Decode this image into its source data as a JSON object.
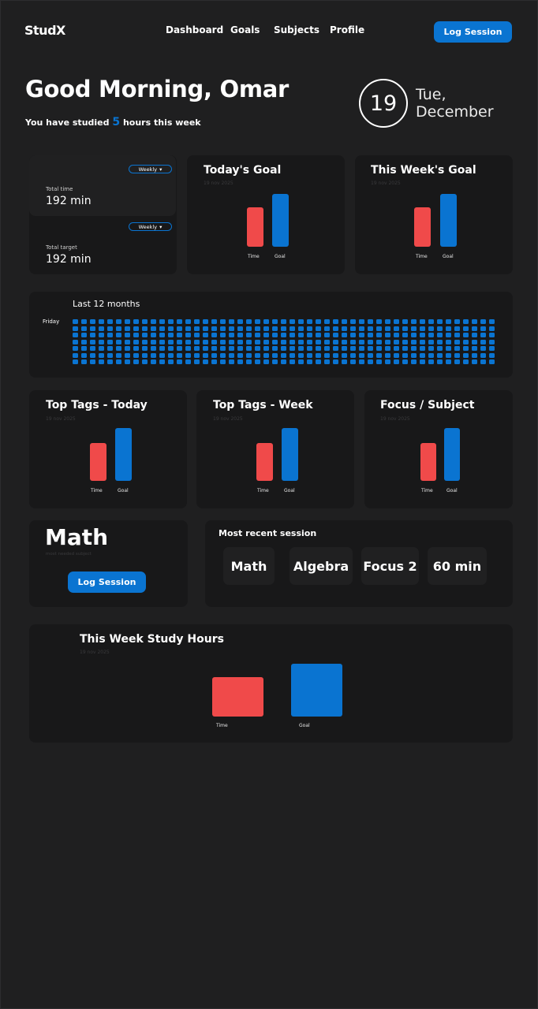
{
  "nav": {
    "logo": "StudX",
    "links": [
      "Dashboard",
      "Goals",
      "Subjects",
      "Profile"
    ],
    "log_session": "Log Session"
  },
  "greeting": {
    "title": "Good Morning, Omar",
    "subtitle_pre": "You have studied",
    "hours": "5",
    "subtitle_post": "hours this week"
  },
  "date": {
    "day_number": "19",
    "weekday": "Tue,",
    "month": "December"
  },
  "totals": {
    "pill_top": "Weekly",
    "pill_bottom": "Weekly",
    "time_label": "Total time",
    "time_value": "192 min",
    "target_label": "Total target",
    "target_value": "192 min"
  },
  "todays_goal": {
    "title": "Today's Goal",
    "date": "19 nov 2025",
    "bars": [
      {
        "label": "Time",
        "value": 0.75
      },
      {
        "label": "Goal",
        "value": 1
      }
    ]
  },
  "weeks_goal": {
    "title": "This Week's Goal",
    "date": "19 nov 2025",
    "bars": [
      {
        "label": "Time",
        "value": 0.75
      },
      {
        "label": "Goal",
        "value": 1
      }
    ]
  },
  "heatmap": {
    "title": "Last 12 months",
    "row_label": "Friday",
    "columns": 49,
    "rows": 7
  },
  "tags_today": {
    "title": "Top Tags - Today",
    "date": "19 nov 2025",
    "bars": [
      {
        "label": "Time",
        "value": 0.72
      },
      {
        "label": "Goal",
        "value": 1
      }
    ]
  },
  "tags_week": {
    "title": "Top Tags - Week",
    "date": "19 nov 2025",
    "bars": [
      {
        "label": "Time",
        "value": 0.72
      },
      {
        "label": "Goal",
        "value": 1
      }
    ]
  },
  "focus_subject": {
    "title": "Focus / Subject",
    "date": "19 nov 2025",
    "bars": [
      {
        "label": "Time",
        "value": 0.72
      },
      {
        "label": "Goal",
        "value": 1
      }
    ]
  },
  "subject": {
    "name": "Math",
    "caption": "most needed subject",
    "button": "Log Session"
  },
  "recent": {
    "title": "Most recent session",
    "items": [
      "Math",
      "Algebra",
      "Focus 2",
      "60 min"
    ]
  },
  "week_hours": {
    "title": "This Week Study Hours",
    "date": "19 nov 2025",
    "bars": [
      {
        "label": "Time",
        "value": 0.74
      },
      {
        "label": "Goal",
        "value": 1
      }
    ]
  },
  "colors": {
    "background": "#1f1f20",
    "card": "#181819",
    "accent": "#0a74d1",
    "time_bar": "#f04a4a"
  }
}
